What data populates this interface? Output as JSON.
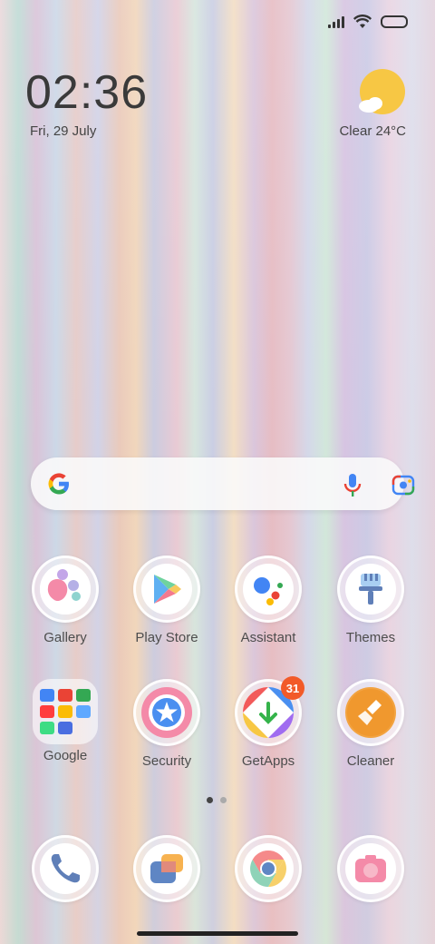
{
  "clock": {
    "time": "02:36",
    "date": "Fri, 29 July"
  },
  "weather": {
    "text": "Clear  24°C",
    "icon": "sun-cloud-icon"
  },
  "apps_row1": [
    {
      "label": "Gallery"
    },
    {
      "label": "Play Store"
    },
    {
      "label": "Assistant"
    },
    {
      "label": "Themes"
    }
  ],
  "apps_row2": [
    {
      "label": "Google"
    },
    {
      "label": "Security"
    },
    {
      "label": "GetApps",
      "badge": "31"
    },
    {
      "label": "Cleaner"
    }
  ],
  "dock": [
    {
      "icon": "phone-icon"
    },
    {
      "icon": "messages-icon"
    },
    {
      "icon": "chrome-icon"
    },
    {
      "icon": "camera-icon"
    }
  ],
  "colors": {
    "badge": "#f25a28",
    "accent_yellow": "#f7c744"
  }
}
